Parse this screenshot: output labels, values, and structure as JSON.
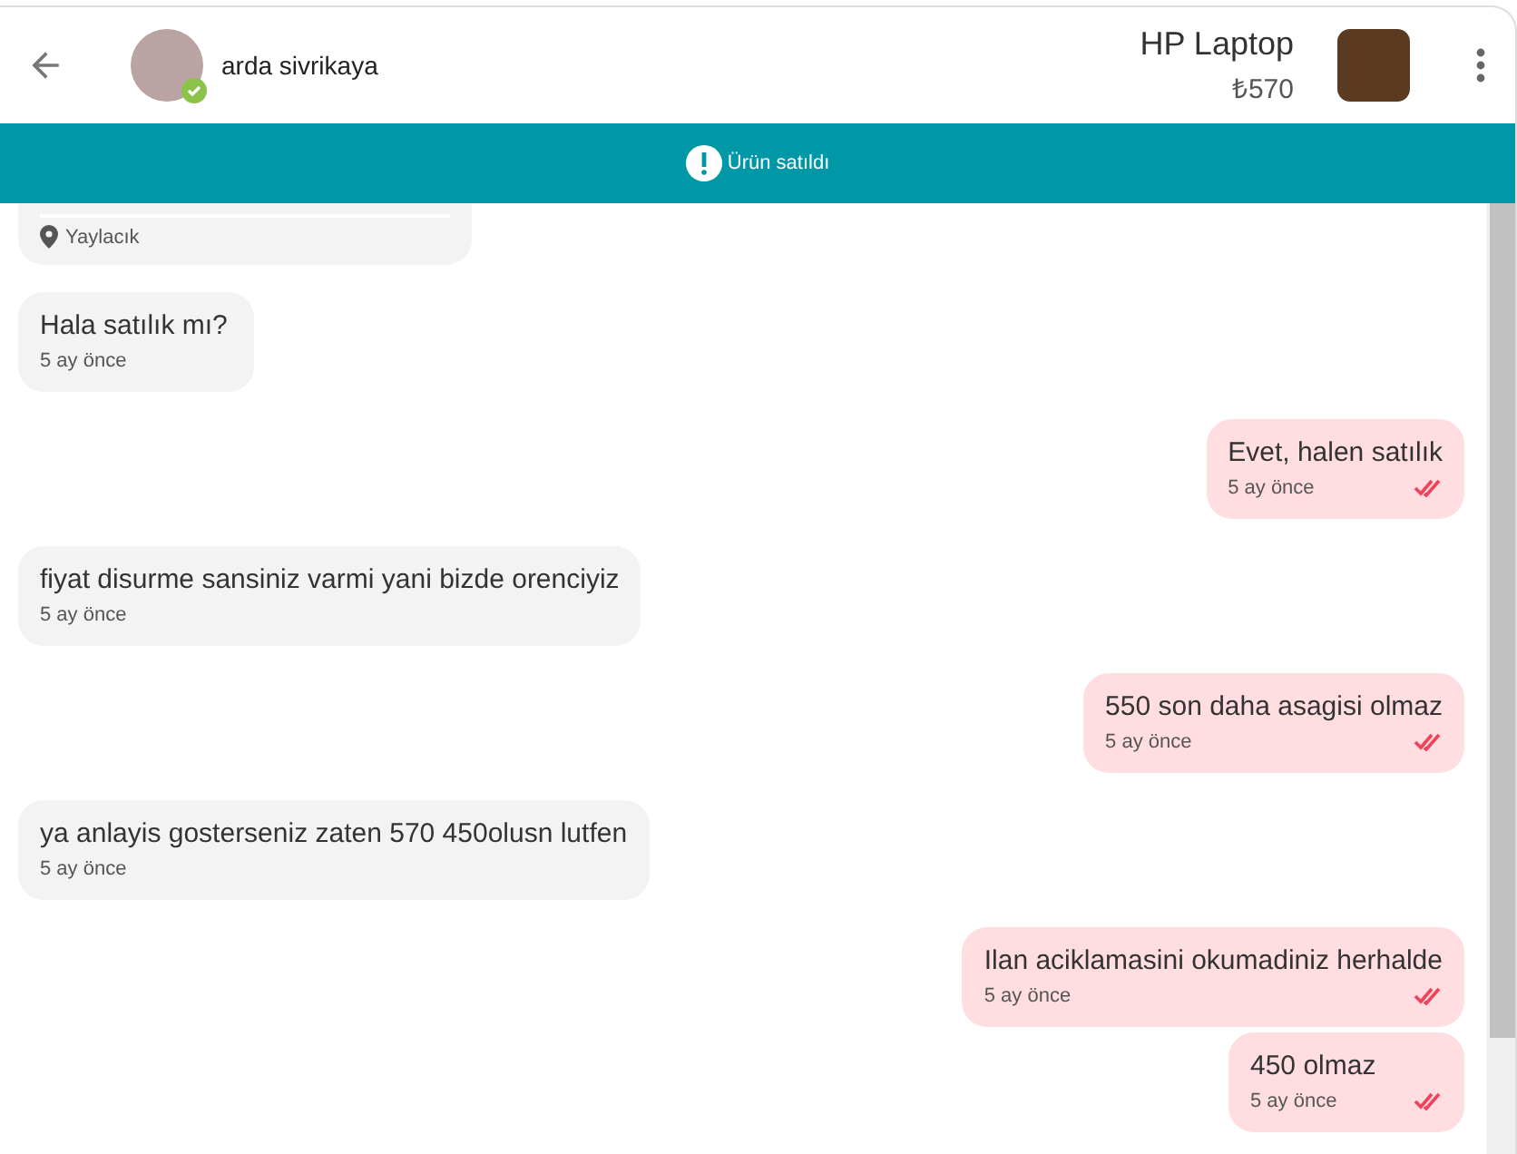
{
  "header": {
    "user_name": "arda sivrikaya",
    "verified": true,
    "product_title": "HP Laptop",
    "product_price": "₺570"
  },
  "banner": {
    "text": "Ürün satıldı"
  },
  "messages": [
    {
      "kind": "location",
      "location": "Yaylacık"
    },
    {
      "kind": "incoming",
      "text": "Hala satılık mı?",
      "time": "5 ay önce"
    },
    {
      "kind": "outgoing",
      "text": "Evet, halen satılık",
      "time": "5 ay önce",
      "read": true
    },
    {
      "kind": "incoming",
      "text": "fiyat disurme sansiniz varmi yani bizde orenciyiz",
      "time": "5 ay önce"
    },
    {
      "kind": "outgoing",
      "text": "550 son daha asagisi olmaz",
      "time": "5 ay önce",
      "read": true
    },
    {
      "kind": "incoming",
      "text": "ya anlayis gosterseniz zaten 570 450olusn lutfen",
      "time": "5 ay önce"
    },
    {
      "kind": "outgoing",
      "text": "Ilan aciklamasini okumadiniz herhalde",
      "time": "5 ay önce",
      "read": true
    },
    {
      "kind": "outgoing",
      "text": "450 olmaz",
      "time": "5 ay önce",
      "read": true
    }
  ]
}
